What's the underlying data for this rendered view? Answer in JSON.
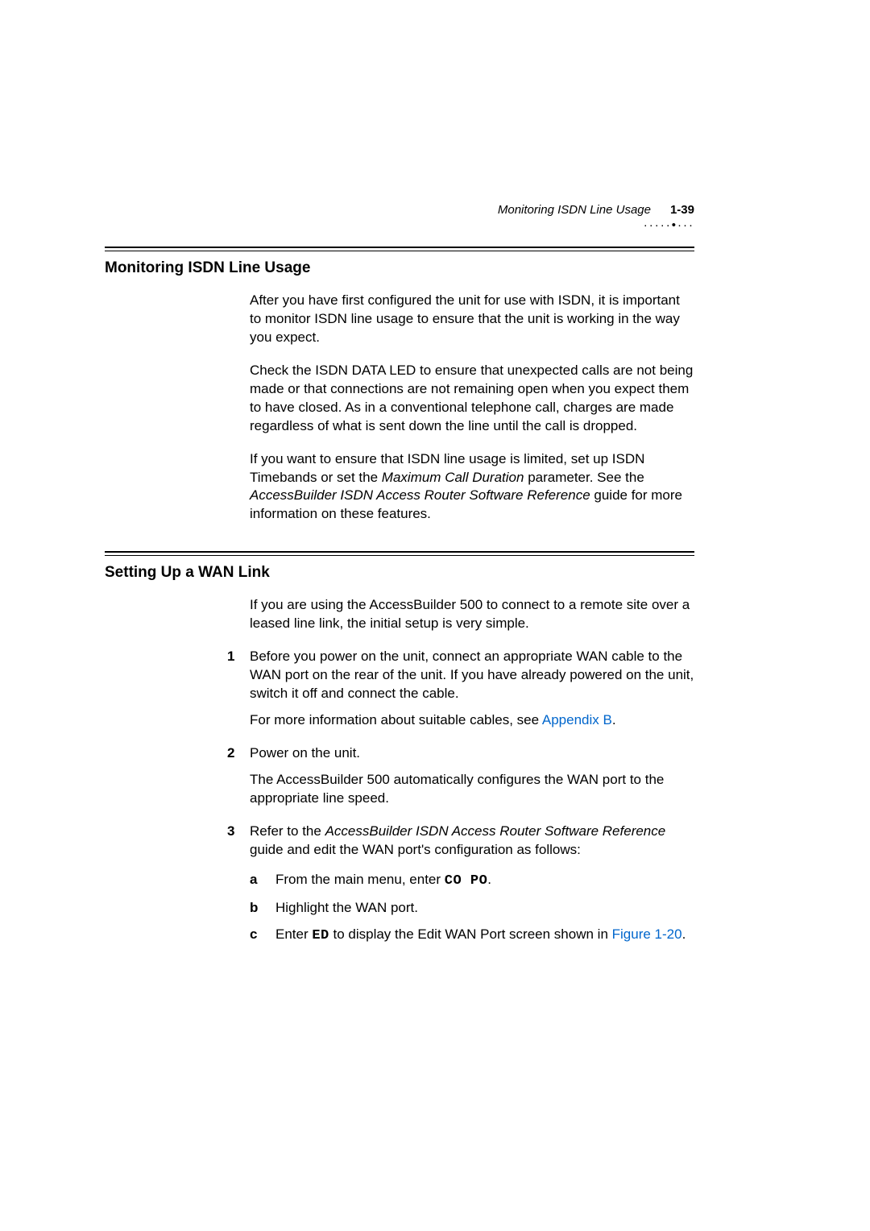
{
  "header": {
    "running_title": "Monitoring ISDN Line Usage",
    "page_number": "1-39",
    "decoration": "·····•···"
  },
  "section1": {
    "heading": "Monitoring ISDN Line Usage",
    "p1": "After you have first configured the unit for use with ISDN, it is important to monitor ISDN line usage to ensure that the unit is working in the way you expect.",
    "p2": "Check the ISDN DATA LED to ensure that unexpected calls are not being made or that connections are not remaining open when you expect them to have closed. As in a conventional telephone call, charges are made regardless of what is sent down the line until the call is dropped.",
    "p3a": "If you want to ensure that ISDN line usage is limited, set up ISDN Timebands or set the ",
    "p3_em1": "Maximum Call Duration",
    "p3b": " parameter. See the ",
    "p3_em2": "AccessBuilder ISDN Access Router Software Reference",
    "p3c": " guide for more information on these features."
  },
  "section2": {
    "heading": "Setting Up a WAN Link",
    "p1": "If you are using the AccessBuilder 500 to connect to a remote site over a leased line link, the initial setup is very simple.",
    "step1_num": "1",
    "step1": "Before you power on the unit, connect an appropriate WAN cable to the WAN port on the rear of the unit. If you have already powered on the unit, switch it off and connect the cable.",
    "step1_follow_a": "For more information about suitable cables, see ",
    "step1_link": "Appendix B",
    "step1_follow_b": ".",
    "step2_num": "2",
    "step2": "Power on the unit.",
    "step2_follow": "The AccessBuilder 500 automatically configures the WAN port to the appropriate line speed.",
    "step3_num": "3",
    "step3a": "Refer to the ",
    "step3_em": "AccessBuilder ISDN Access Router Software Reference",
    "step3b": " guide and edit the WAN port's configuration as follows:",
    "sub_a_letter": "a",
    "sub_a_1": "From the main menu, enter ",
    "sub_a_code": "CO PO",
    "sub_a_2": ".",
    "sub_b_letter": "b",
    "sub_b": "Highlight the WAN port.",
    "sub_c_letter": "c",
    "sub_c_1": "Enter ",
    "sub_c_code": "ED",
    "sub_c_2": " to display the Edit WAN Port screen shown in ",
    "sub_c_link": "Figure 1-20",
    "sub_c_3": "."
  }
}
